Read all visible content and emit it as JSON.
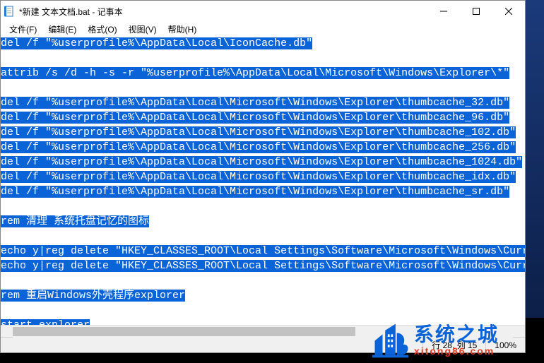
{
  "title": "*新建 文本文档.bat - 记事本",
  "menu": {
    "file": "文件(F)",
    "edit": "编辑(E)",
    "format": "格式(O)",
    "view": "视图(V)",
    "help": "帮助(H)"
  },
  "lines": [
    "del /f \"%userprofile%\\AppData\\Local\\IconCache.db\"",
    "",
    "attrib /s /d -h -s -r \"%userprofile%\\AppData\\Local\\Microsoft\\Windows\\Explorer\\*\"",
    "",
    "del /f \"%userprofile%\\AppData\\Local\\Microsoft\\Windows\\Explorer\\thumbcache_32.db\"",
    "del /f \"%userprofile%\\AppData\\Local\\Microsoft\\Windows\\Explorer\\thumbcache_96.db\"",
    "del /f \"%userprofile%\\AppData\\Local\\Microsoft\\Windows\\Explorer\\thumbcache_102.db\"",
    "del /f \"%userprofile%\\AppData\\Local\\Microsoft\\Windows\\Explorer\\thumbcache_256.db\"",
    "del /f \"%userprofile%\\AppData\\Local\\Microsoft\\Windows\\Explorer\\thumbcache_1024.db\"",
    "del /f \"%userprofile%\\AppData\\Local\\Microsoft\\Windows\\Explorer\\thumbcache_idx.db\"",
    "del /f \"%userprofile%\\AppData\\Local\\Microsoft\\Windows\\Explorer\\thumbcache_sr.db\"",
    "",
    "rem 清理 系统托盘记忆的图标",
    "",
    "echo y|reg delete \"HKEY_CLASSES_ROOT\\Local Settings\\Software\\Microsoft\\Windows\\CurrentV",
    "echo y|reg delete \"HKEY_CLASSES_ROOT\\Local Settings\\Software\\Microsoft\\Windows\\CurrentV",
    "",
    "rem 重启Windows外壳程序explorer",
    "",
    "start explorer"
  ],
  "status": {
    "pos": "行 28, 列 15",
    "zoom": "100%"
  },
  "watermark": {
    "zh": "系统之城",
    "url": "xitong86.com"
  }
}
